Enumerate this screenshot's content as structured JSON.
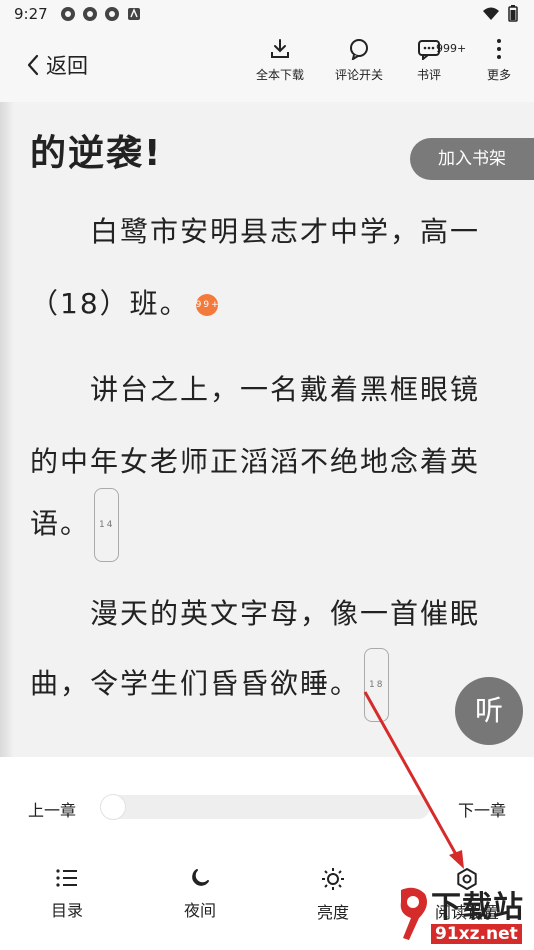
{
  "status_bar": {
    "time": "9:27"
  },
  "top_bar": {
    "back_label": "返回",
    "tools": [
      {
        "label": "全本下载",
        "icon": "download-icon"
      },
      {
        "label": "评论开关",
        "icon": "comment-toggle-icon"
      },
      {
        "label": "书评",
        "icon": "review-icon",
        "badge": "999+"
      },
      {
        "label": "更多",
        "icon": "more-icon"
      }
    ]
  },
  "reader": {
    "chapter_title": "的逆袭!",
    "paragraphs": [
      {
        "line1": "白鹭市安明县志才中学，高一",
        "line2": "（18）班。",
        "badge": "99+"
      },
      {
        "line1": "讲台之上，一名戴着黑框眼镜",
        "line2": "的中年女老师正滔滔不绝地念着英",
        "line3": "语。",
        "comments": "14"
      },
      {
        "line1": "漫天的英文字母，像一首催眠",
        "line2": "曲，令学生们昏昏欲睡。",
        "comments": "18"
      }
    ],
    "add_to_shelf": "加入书架",
    "listen": "听"
  },
  "bottom_panel": {
    "prev_chapter": "上一章",
    "next_chapter": "下一章",
    "progress": 0.0,
    "nav": [
      {
        "label": "目录",
        "icon": "catalog-icon"
      },
      {
        "label": "夜间",
        "icon": "night-mode-icon"
      },
      {
        "label": "亮度",
        "icon": "brightness-icon"
      },
      {
        "label": "阅读设置",
        "icon": "reading-settings-icon"
      }
    ]
  },
  "watermark": {
    "text": "下载站",
    "url": "91xz.net"
  },
  "colors": {
    "annotation_arrow": "#d62b2b",
    "listen_button": "#777777",
    "shelf_button": "#7a7a7a"
  }
}
